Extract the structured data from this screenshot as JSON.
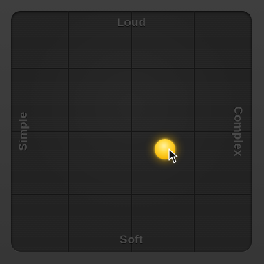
{
  "pad": {
    "labels": {
      "top": "Loud",
      "bottom": "Soft",
      "left": "Simple",
      "right": "Complex"
    },
    "puck": {
      "complexity": 0.64,
      "loudness": 0.5,
      "color": "#f6b400"
    },
    "icons": {
      "cursor": "arrow-pointer-icon"
    }
  }
}
